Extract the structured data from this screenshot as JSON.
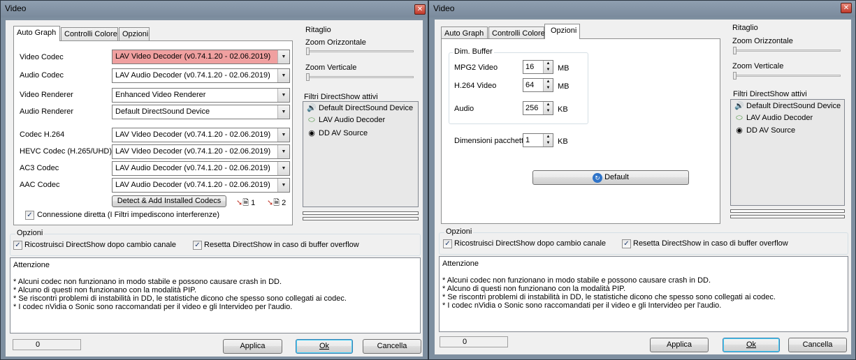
{
  "left": {
    "title": "Video",
    "tabs": [
      "Auto Graph",
      "Controlli Colore",
      "Opzioni"
    ],
    "rows": [
      {
        "label": "Video Codec",
        "value": "LAV Video Decoder   (v0.74.1.20 - 02.06.2019)",
        "warn": true
      },
      {
        "label": "Audio Codec",
        "value": "LAV Audio Decoder   (v0.74.1.20 - 02.06.2019)"
      },
      {
        "label": "Video Renderer",
        "value": "Enhanced Video Renderer"
      },
      {
        "label": "Audio Renderer",
        "value": "Default DirectSound Device"
      },
      {
        "label": "Codec H.264",
        "value": "LAV Video Decoder   (v0.74.1.20 - 02.06.2019)"
      },
      {
        "label": "HEVC Codec (H.265/UHD)",
        "value": "LAV Video Decoder   (v0.74.1.20 - 02.06.2019)"
      },
      {
        "label": "AC3 Codec",
        "value": "LAV Audio Decoder   (v0.74.1.20 - 02.06.2019)"
      },
      {
        "label": "AAC Codec",
        "value": "LAV Audio Decoder   (v0.74.1.20 - 02.06.2019)"
      }
    ],
    "detect_button": "Detect & Add Installed Codecs",
    "link1": "1",
    "link2": "2",
    "direct_connection": "Connessione diretta (I Filtri impediscono interferenze)"
  },
  "right": {
    "title": "Video",
    "tabs": [
      "Auto Graph",
      "Controlli Colore",
      "Opzioni"
    ],
    "buffer_group": "Dim. Buffer",
    "mpg2_label": "MPG2 Video",
    "mpg2_value": "16",
    "mpg2_unit": "MB",
    "h264_label": "H.264 Video",
    "h264_value": "64",
    "h264_unit": "MB",
    "audio_label": "Audio",
    "audio_value": "256",
    "audio_unit": "KB",
    "packet_label": "Dimensioni pacchetto",
    "packet_value": "1",
    "packet_unit": "KB",
    "default_button": "Default"
  },
  "common": {
    "ritaglio": "Ritaglio",
    "zoom_h": "Zoom Orizzontale",
    "zoom_v": "Zoom Verticale",
    "filters_title": "Filtri DirectShow attivi",
    "filters": [
      "Default DirectSound Device",
      "LAV Audio Decoder",
      "DD AV Source"
    ],
    "options_title": "Opzioni",
    "opt1": "Ricostruisci DirectShow dopo cambio canale",
    "opt2": "Resetta DirectShow in caso di buffer overflow",
    "attention_title": "Attenzione",
    "attention_lines": [
      "*  Alcuni codec non funzionano in modo stabile e possono causare crash in DD.",
      "*  Alcuno di questi non funzionano con la modalità PIP.",
      "*  Se riscontri problemi di instabilità in DD, le statistiche dicono che spesso sono collegati ai codec.",
      "*  I codec nVidia o Sonic sono raccomandati per il video e gli Intervideo per l'audio."
    ],
    "status_value": "0",
    "apply": "Applica",
    "ok": "Ok",
    "cancel": "Cancella"
  }
}
